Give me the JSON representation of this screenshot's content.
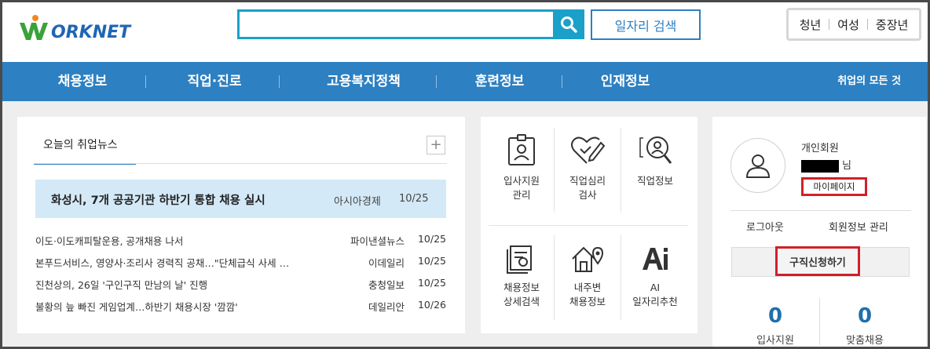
{
  "header": {
    "logo_text": "ORKNET",
    "search_placeholder": "",
    "job_search_label": "일자리 검색",
    "segments": [
      "청년",
      "여성",
      "중장년"
    ]
  },
  "nav": {
    "items": [
      "채용정보",
      "직업·진로",
      "고용복지정책",
      "훈련정보",
      "인재정보"
    ],
    "all_label": "취업의 모든 것"
  },
  "news": {
    "tab_label": "오늘의 취업뉴스",
    "more_label": "+",
    "headline": {
      "title": "화성시, 7개 공공기관 하반기 통합 채용 실시",
      "source": "아시아경제",
      "date": "10/25"
    },
    "items": [
      {
        "title": "이도·이도캐피탈운용, 공개채용 나서",
        "source": "파이낸셜뉴스",
        "date": "10/25"
      },
      {
        "title": "본푸드서비스, 영양사·조리사 경력직 공채…\"단체급식 사세 …",
        "source": "이데일리",
        "date": "10/25"
      },
      {
        "title": "진천상의, 26일 '구인구직 만남의 날' 진행",
        "source": "충청일보",
        "date": "10/25"
      },
      {
        "title": "불황의 늪 빠진 게임업계…하반기 채용시장 '깜깜'",
        "source": "데일리안",
        "date": "10/26"
      }
    ]
  },
  "services": [
    {
      "icon": "id-badge-icon",
      "label_line1": "입사지원",
      "label_line2": "관리"
    },
    {
      "icon": "heart-pen-icon",
      "label_line1": "직업심리",
      "label_line2": "검사"
    },
    {
      "icon": "magnifier-person-icon",
      "label_line1": "직업정보",
      "label_line2": ""
    },
    {
      "icon": "document-search-icon",
      "label_line1": "채용정보",
      "label_line2": "상세검색"
    },
    {
      "icon": "house-pin-icon",
      "label_line1": "내주변",
      "label_line2": "채용정보"
    },
    {
      "icon": "ai-icon",
      "label_line1": "AI",
      "label_line2": "일자리추천"
    }
  ],
  "member": {
    "type_label": "개인회원",
    "name_suffix": "님",
    "mypage_label": "마이페이지",
    "logout_label": "로그아웃",
    "profile_label": "회원정보 관리",
    "apply_label": "구직신청하기",
    "stats": [
      {
        "value": "0",
        "label": "입사지원"
      },
      {
        "value": "0",
        "label": "맞춤채용"
      }
    ]
  },
  "colors": {
    "brand_blue": "#2d80c2",
    "search_teal": "#1aa0c9",
    "logo_green": "#3aa23a",
    "logo_orange": "#f08a1c",
    "highlight_red": "#d0202a",
    "stat_blue": "#1f6fad"
  }
}
